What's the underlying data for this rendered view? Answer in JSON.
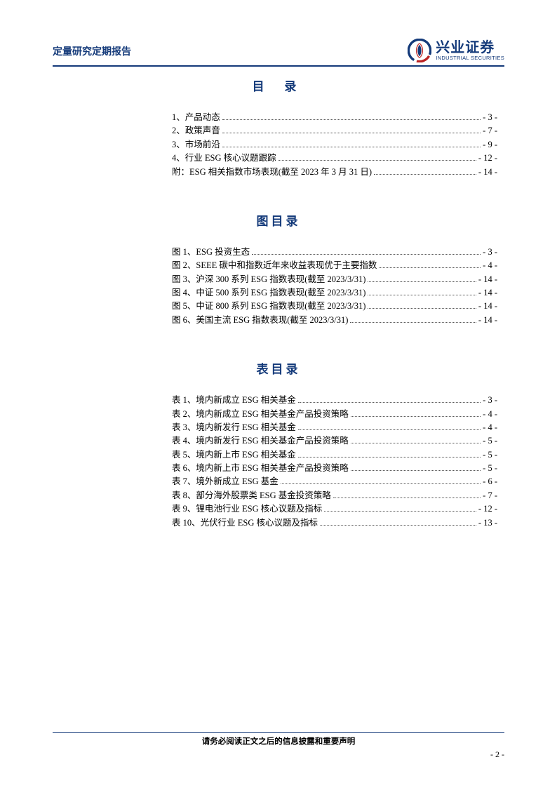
{
  "header": {
    "doc_type": "定量研究定期报告",
    "logo_cn": "兴业证券",
    "logo_en": "INDUSTRIAL SECURITIES"
  },
  "sections": {
    "toc_title": "目 录",
    "fig_title": "图目录",
    "tab_title": "表目录"
  },
  "toc": [
    {
      "label": "1、产品动态",
      "page": "- 3 -"
    },
    {
      "label": "2、政策声音",
      "page": "- 7 -"
    },
    {
      "label": "3、市场前沿",
      "page": "- 9 -"
    },
    {
      "label": "4、行业 ESG 核心议题跟踪",
      "page": "- 12 -"
    },
    {
      "label": "附：ESG 相关指数市场表现(截至 2023 年 3 月 31 日)",
      "page": "- 14 -"
    }
  ],
  "figures": [
    {
      "label": "图 1、ESG 投资生态",
      "page": "- 3 -"
    },
    {
      "label": "图 2、SEEE 碳中和指数近年来收益表现优于主要指数",
      "page": "- 4 -"
    },
    {
      "label": "图 3、沪深 300 系列 ESG 指数表现(截至 2023/3/31)",
      "page": "- 14 -"
    },
    {
      "label": "图 4、中证 500 系列 ESG 指数表现(截至 2023/3/31)",
      "page": "- 14 -"
    },
    {
      "label": "图 5、中证 800 系列 ESG 指数表现(截至 2023/3/31)",
      "page": "- 14 -"
    },
    {
      "label": "图 6、美国主流 ESG 指数表现(截至 2023/3/31)",
      "page": "- 14 -"
    }
  ],
  "tables": [
    {
      "label": "表 1、境内新成立 ESG 相关基金",
      "page": "- 3 -"
    },
    {
      "label": "表 2、境内新成立 ESG 相关基金产品投资策略",
      "page": "- 4 -"
    },
    {
      "label": "表 3、境内新发行 ESG 相关基金",
      "page": "- 4 -"
    },
    {
      "label": "表 4、境内新发行 ESG 相关基金产品投资策略",
      "page": "- 5 -"
    },
    {
      "label": "表 5、境内新上市 ESG 相关基金",
      "page": "- 5 -"
    },
    {
      "label": "表 6、境内新上市 ESG 相关基金产品投资策略",
      "page": "- 5 -"
    },
    {
      "label": "表 7、境外新成立 ESG 基金",
      "page": "- 6 -"
    },
    {
      "label": "表 8、部分海外股票类 ESG 基金投资策略",
      "page": "- 7 -"
    },
    {
      "label": "表 9、锂电池行业 ESG 核心议题及指标",
      "page": "- 12 -"
    },
    {
      "label": "表 10、光伏行业 ESG 核心议题及指标",
      "page": "- 13 -"
    }
  ],
  "footer": {
    "disclaimer": "请务必阅读正文之后的信息披露和重要声明",
    "pagenum": "- 2 -"
  }
}
